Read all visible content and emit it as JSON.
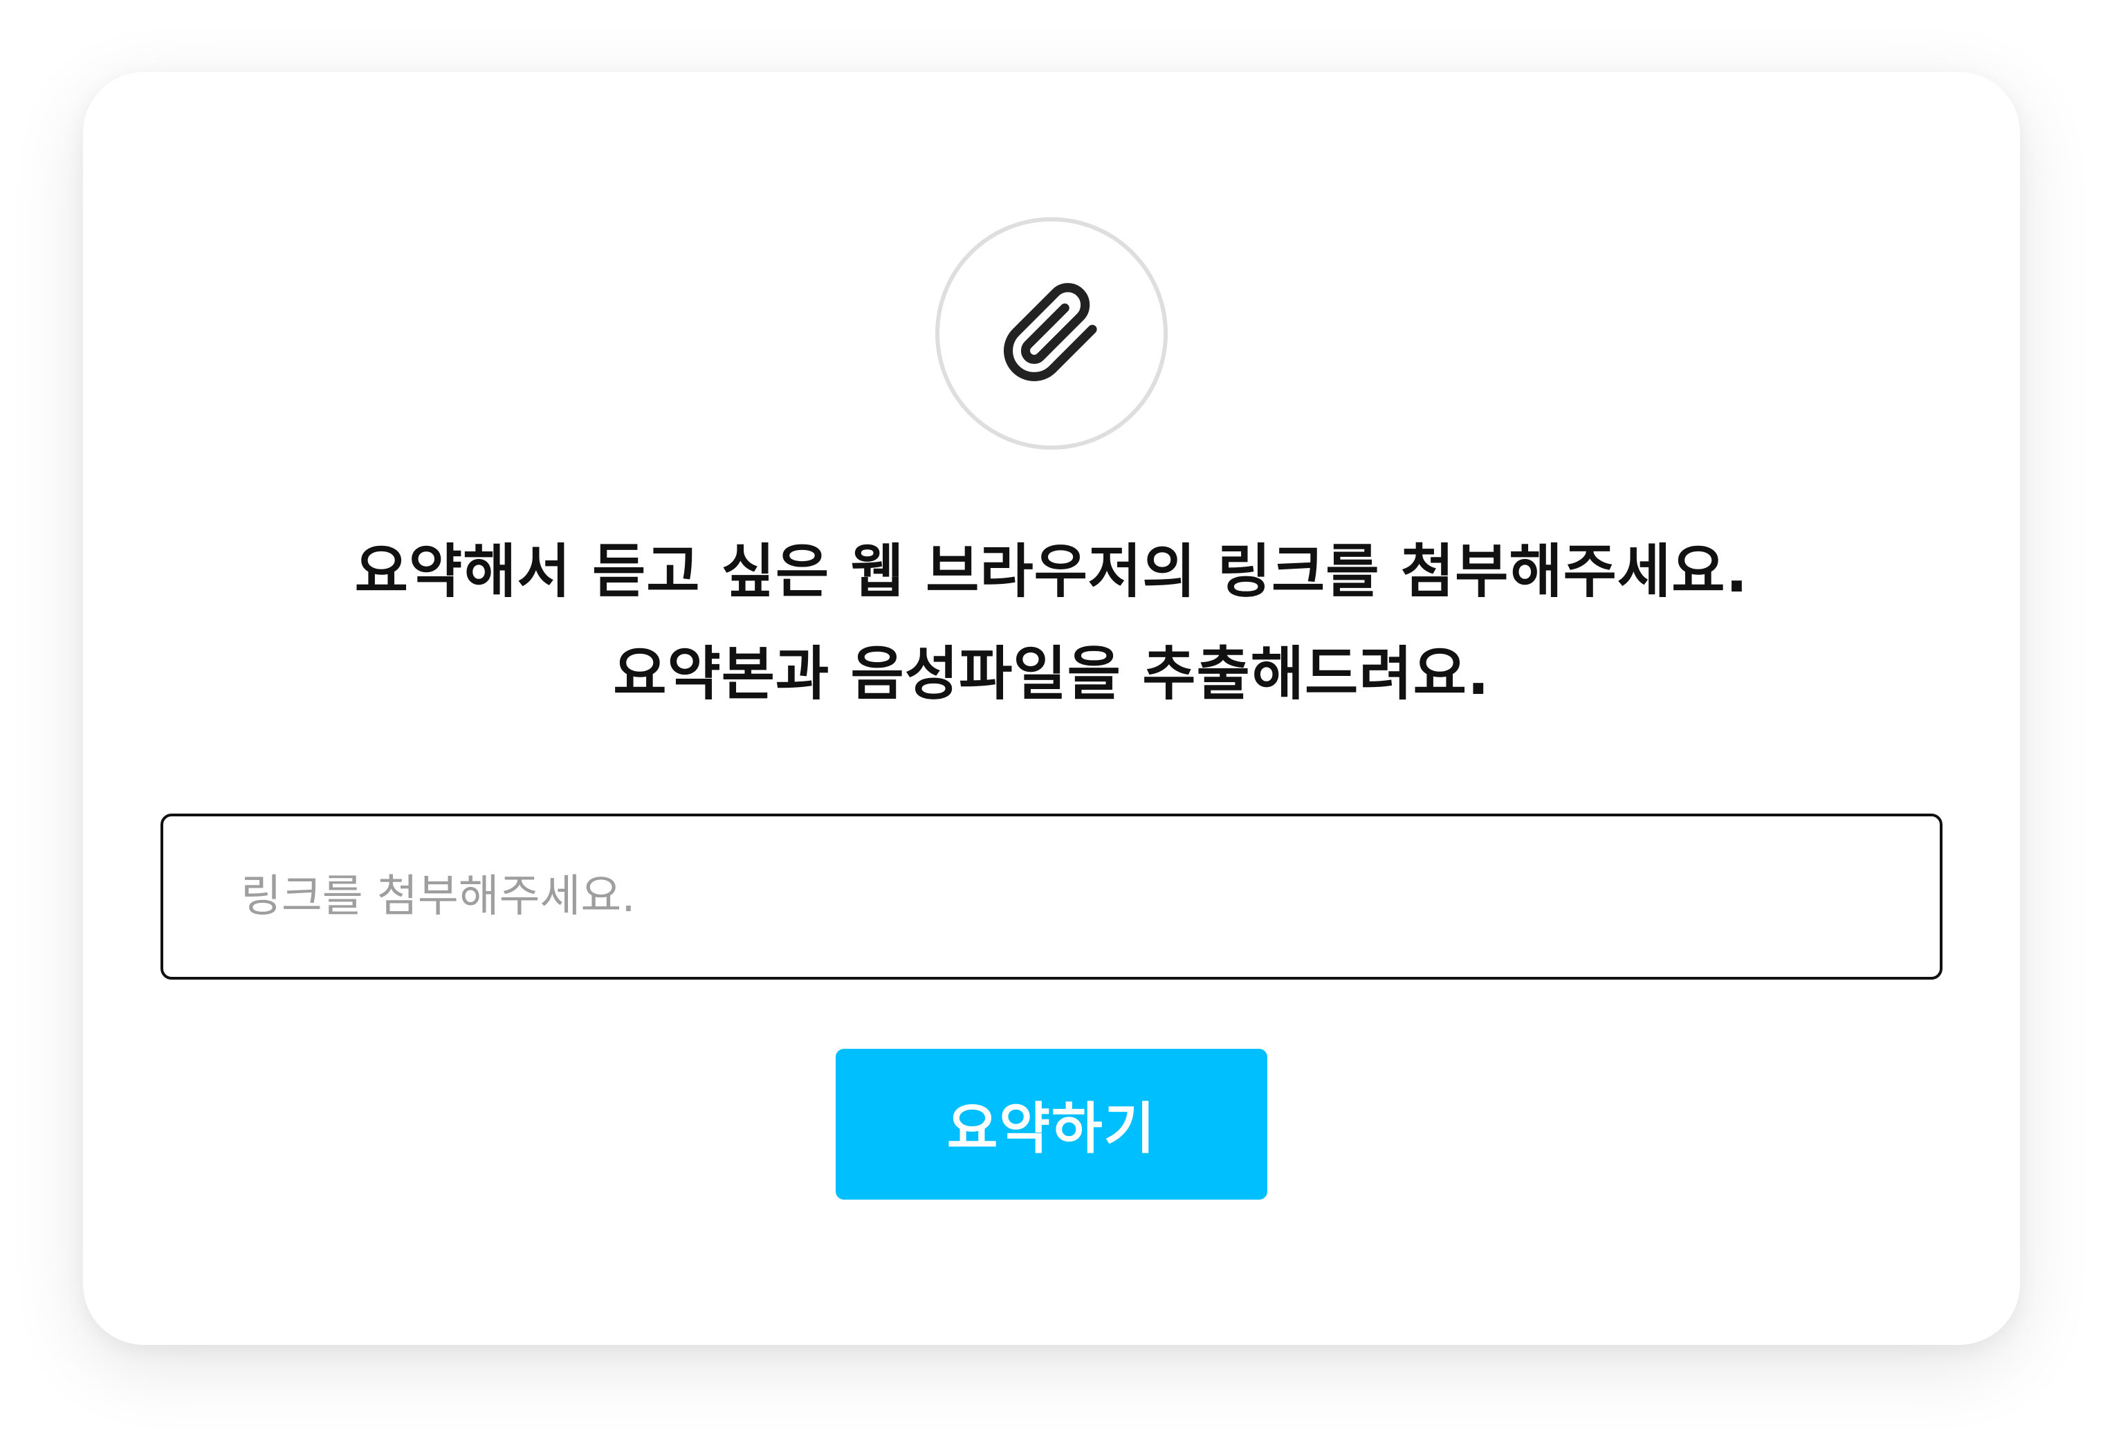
{
  "card": {
    "icon": "paperclip-icon",
    "headline_line1": "요약해서 듣고 싶은 웹 브라우저의 링크를 첨부해주세요.",
    "headline_line2": "요약본과 음성파일을 추출해드려요."
  },
  "link_input": {
    "placeholder": "링크를 첨부해주세요.",
    "value": ""
  },
  "submit_button": {
    "label": "요약하기"
  },
  "colors": {
    "accent": "#00bfff",
    "text": "#111111",
    "placeholder": "#9e9e9e",
    "icon_circle_border": "#dedede"
  }
}
